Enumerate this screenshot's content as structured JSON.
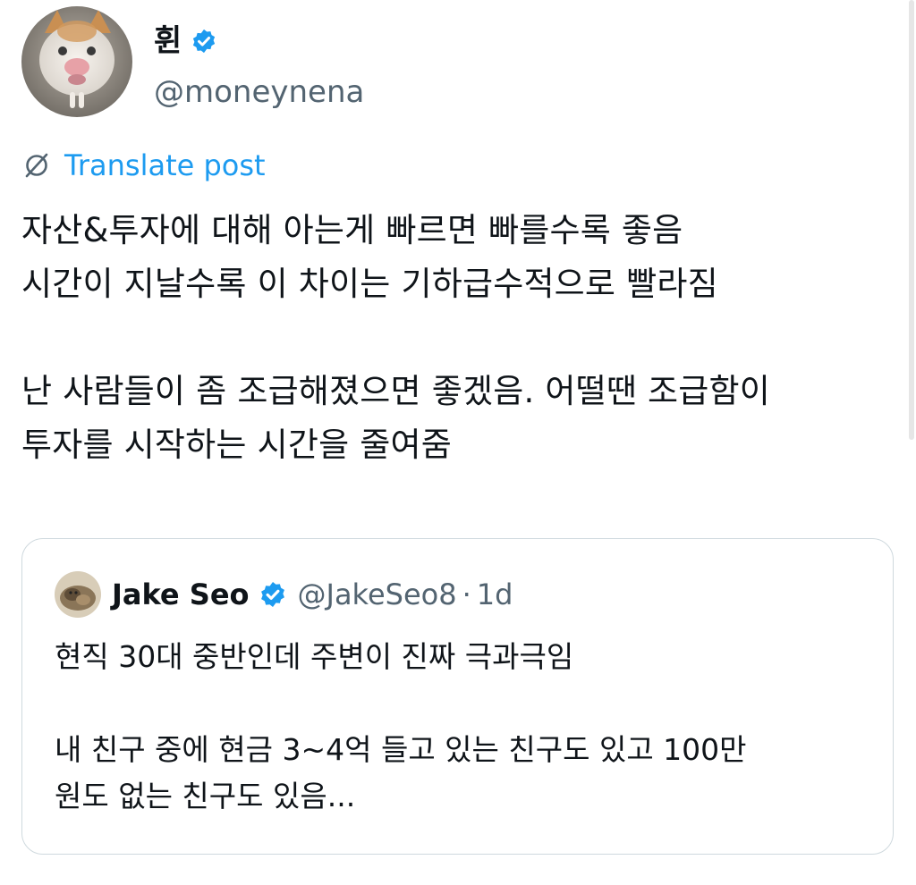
{
  "author": {
    "display_name": "휜",
    "handle": "@moneynena",
    "verified_icon": "verified-badge-icon",
    "avatar": "cat-avatar"
  },
  "translate": {
    "label": "Translate post",
    "icon": "translate-globe-icon"
  },
  "tweet": {
    "lines": [
      "자산&투자에 대해 아는게 빠르면 빠를수록 좋음",
      "시간이 지날수록 이 차이는 기하급수적으로 빨라짐",
      "",
      "난 사람들이 좀 조급해졌으면 좋겠음. 어떨땐 조급함이",
      "투자를 시작하는 시간을 줄여줌"
    ]
  },
  "quote": {
    "display_name": "Jake Seo",
    "handle": "@JakeSeo8",
    "separator": "·",
    "time": "1d",
    "lines": [
      "현직 30대 중반인데 주변이 진짜 극과극임",
      "",
      "내 친구 중에 현금 3~4억 들고 있는 친구도 있고 100만",
      "원도 없는 친구도 있음..."
    ]
  },
  "colors": {
    "accent": "#1d9bf0",
    "secondary_text": "#536471",
    "primary_text": "#0f1419",
    "border": "#cfd9de"
  }
}
